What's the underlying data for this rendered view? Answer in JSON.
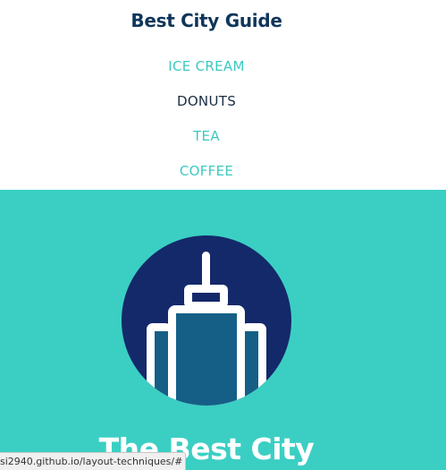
{
  "header": {
    "title": "Best City Guide"
  },
  "nav": {
    "items": [
      {
        "label": "ICE CREAM",
        "active": false
      },
      {
        "label": "DONUTS",
        "active": true
      },
      {
        "label": "TEA",
        "active": false
      },
      {
        "label": "COFFEE",
        "active": false
      }
    ]
  },
  "hero": {
    "title": "The Best City",
    "logo_icon": "skyscraper-icon"
  },
  "status_bar": {
    "url": "si2940.github.io/layout-techniques/#"
  },
  "colors": {
    "accent": "#3bcfc3",
    "nav_link": "#3cc9c0",
    "nav_active": "#1b2d44",
    "title": "#10365a",
    "logo_circle": "#14296a",
    "building_fill": "#155f87"
  }
}
